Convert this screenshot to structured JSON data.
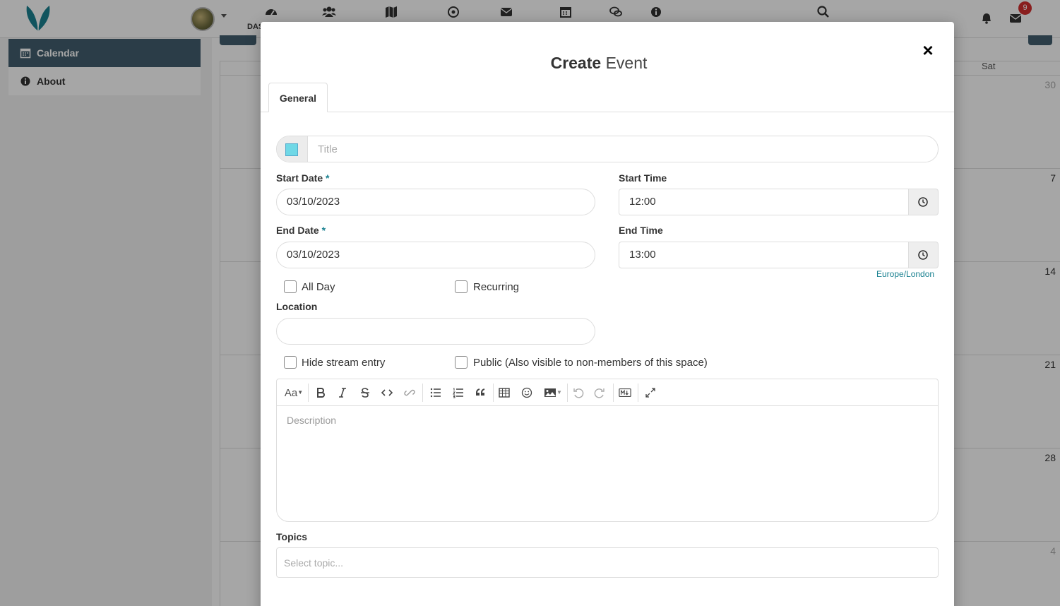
{
  "topbar": {
    "nav_text": "DAS",
    "notification_count": "9",
    "icons": [
      "dashboard-icon",
      "people-icon",
      "map-icon",
      "target-icon",
      "envelope-icon",
      "calendar-icon",
      "chat-icon",
      "info-icon",
      "search-icon",
      "bell-icon",
      "mail-icon"
    ]
  },
  "sidebar": {
    "items": [
      {
        "label": "Calendar",
        "icon": "calendar-icon"
      },
      {
        "label": "About",
        "icon": "info-icon"
      }
    ]
  },
  "calendar": {
    "header_day": "Sat",
    "dates": [
      "30",
      "7",
      "14",
      "21",
      "28",
      "4"
    ]
  },
  "modal": {
    "title_bold": "Create",
    "title_rest": " Event",
    "close": "×",
    "tab": "General",
    "title_placeholder": "Title",
    "color": "#6fd8e6",
    "start_date_label": "Start Date",
    "required_mark": "*",
    "start_date": "03/10/2023",
    "start_time_label": "Start Time",
    "start_time": "12:00",
    "end_date_label": "End Date",
    "end_date": "03/10/2023",
    "end_time_label": "End Time",
    "end_time": "13:00",
    "timezone": "Europe/London",
    "all_day": "All Day",
    "recurring": "Recurring",
    "location_label": "Location",
    "hide_stream": "Hide stream entry",
    "public": "Public (Also visible to non-members of this space)",
    "editor": {
      "heading_btn": "Aa",
      "description_placeholder": "Description"
    },
    "topics_label": "Topics",
    "topics_placeholder": "Select topic..."
  }
}
